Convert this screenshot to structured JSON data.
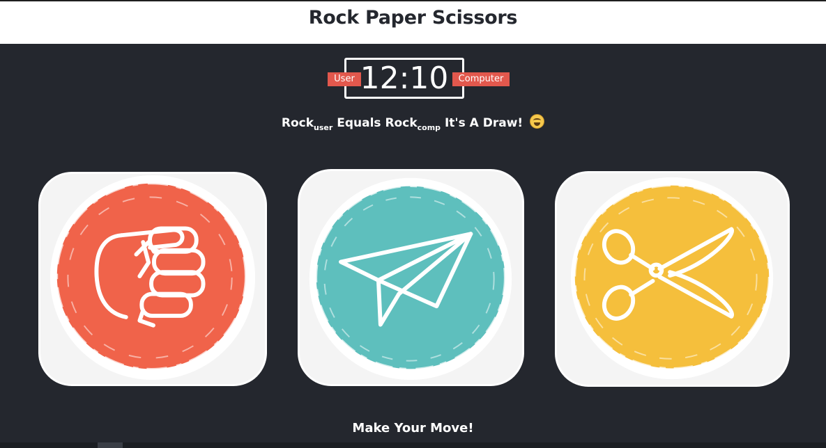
{
  "app": {
    "title": "Rock Paper Scissors"
  },
  "scoreboard": {
    "score": "12:10",
    "user_label": "User",
    "computer_label": "Computer"
  },
  "result": {
    "user_choice": "Rock",
    "user_sub": "user",
    "verb": "Equals",
    "comp_choice": "Rock",
    "comp_sub": "comp",
    "message": "It's A Draw!",
    "emoji": "laughing-face-icon"
  },
  "choices": [
    {
      "name": "rock",
      "icon": "fist-icon",
      "color": "#f0634a"
    },
    {
      "name": "paper",
      "icon": "paper-plane-icon",
      "color": "#5ebfbd"
    },
    {
      "name": "scissors",
      "icon": "scissors-icon",
      "color": "#f5bf3c"
    }
  ],
  "footer": {
    "prompt": "Make Your Move!"
  }
}
